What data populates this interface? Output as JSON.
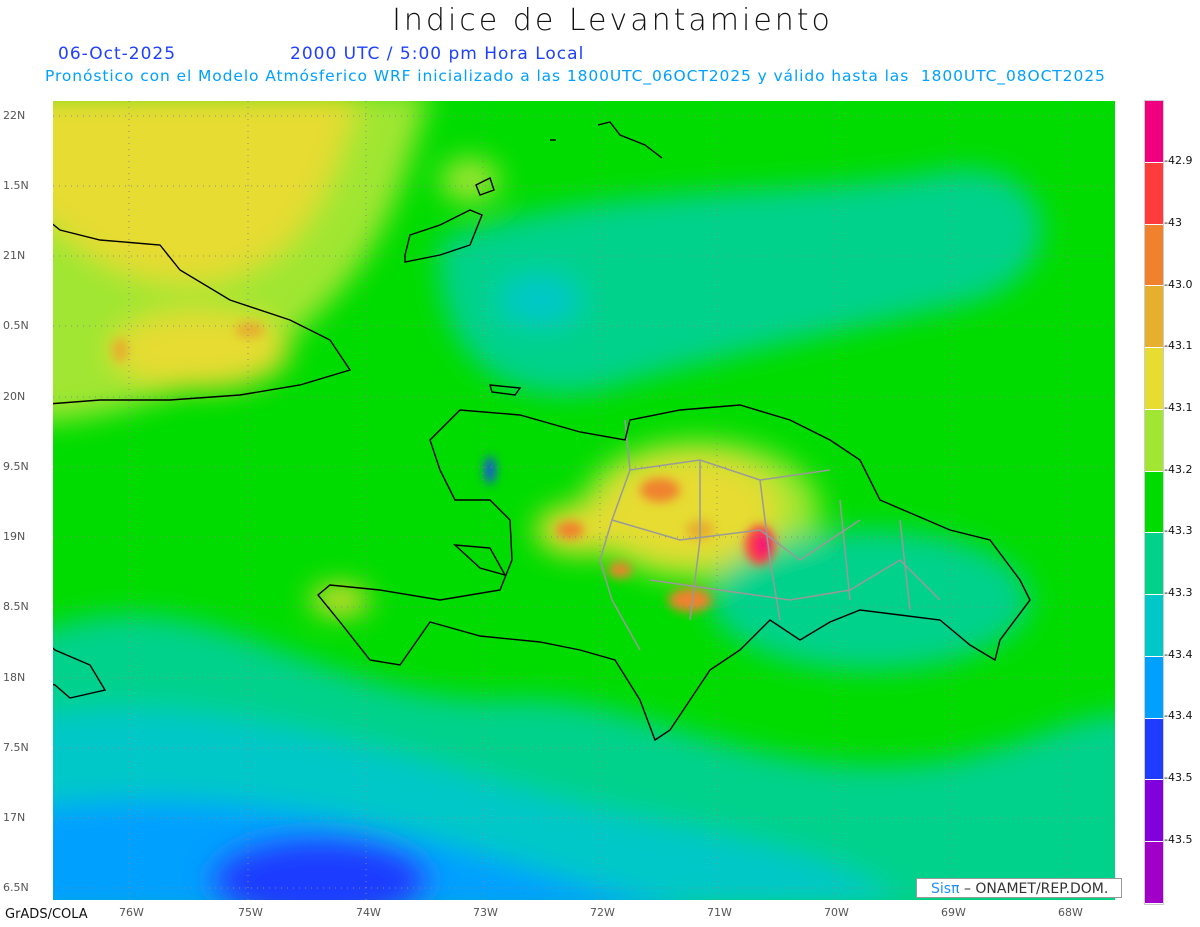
{
  "title": "Indice de Levantamiento",
  "date": "06-Oct-2025",
  "time": "2000 UTC / 5:00 pm Hora Local",
  "subtitle": "Pronóstico con el Modelo Atmósferico WRF inicializado a las 1800UTC_06OCT2025 y válido hasta las  1800UTC_08OCT2025",
  "lat_labels": [
    "22N",
    "1.5N",
    "21N",
    "0.5N",
    "20N",
    "9.5N",
    "19N",
    "8.5N",
    "18N",
    "7.5N",
    "17N",
    "6.5N"
  ],
  "lon_labels": [
    "76W",
    "75W",
    "74W",
    "73W",
    "72W",
    "71W",
    "70W",
    "69W",
    "68W"
  ],
  "colorbar": {
    "colors": [
      "#f0007f",
      "#ff3c3c",
      "#f0822d",
      "#e6af2d",
      "#e6dc32",
      "#a0e632",
      "#00dc00",
      "#00d28c",
      "#00c8c8",
      "#00a0ff",
      "#1e3cff",
      "#8200dc",
      "#a000c8"
    ],
    "labels": [
      "-42.9",
      "-43",
      "-43.0",
      "-43.1",
      "-43.1",
      "-43.2",
      "-43.3",
      "-43.3",
      "-43.4",
      "-43.4",
      "-43.5",
      "-43.5"
    ]
  },
  "footer": {
    "software": "GrADS/COLA",
    "logo_brand": "Sisπ",
    "logo_text": "– ONAMET/REP.DOM."
  }
}
